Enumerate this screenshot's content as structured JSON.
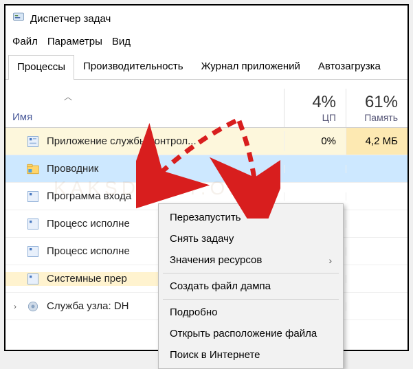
{
  "window": {
    "title": "Диспетчер задач"
  },
  "menu": {
    "file": "Файл",
    "options": "Параметры",
    "view": "Вид"
  },
  "tabs": {
    "processes": "Процессы",
    "performance": "Производительность",
    "apphistory": "Журнал приложений",
    "startup": "Автозагрузка"
  },
  "columns": {
    "name": "Имя",
    "cpu_pct": "4%",
    "cpu_label": "ЦП",
    "mem_pct": "61%",
    "mem_label": "Память"
  },
  "rows": [
    {
      "label": "Приложение службы контрол...",
      "cpu": "0%",
      "mem": "4,2 МБ"
    },
    {
      "label": "Проводник"
    },
    {
      "label": "Программа входа"
    },
    {
      "label": "Процесс исполне"
    },
    {
      "label": "Процесс исполне"
    },
    {
      "label": "Системные прер"
    },
    {
      "label": "Служба узла: DH"
    }
  ],
  "context": {
    "restart": "Перезапустить",
    "endtask": "Снять задачу",
    "resources": "Значения ресурсов",
    "dump": "Создать файл дампа",
    "details": "Подробно",
    "openloc": "Открыть расположение файла",
    "search": "Поиск в Интернете"
  },
  "watermark": "KAKSDELAT.ORG"
}
